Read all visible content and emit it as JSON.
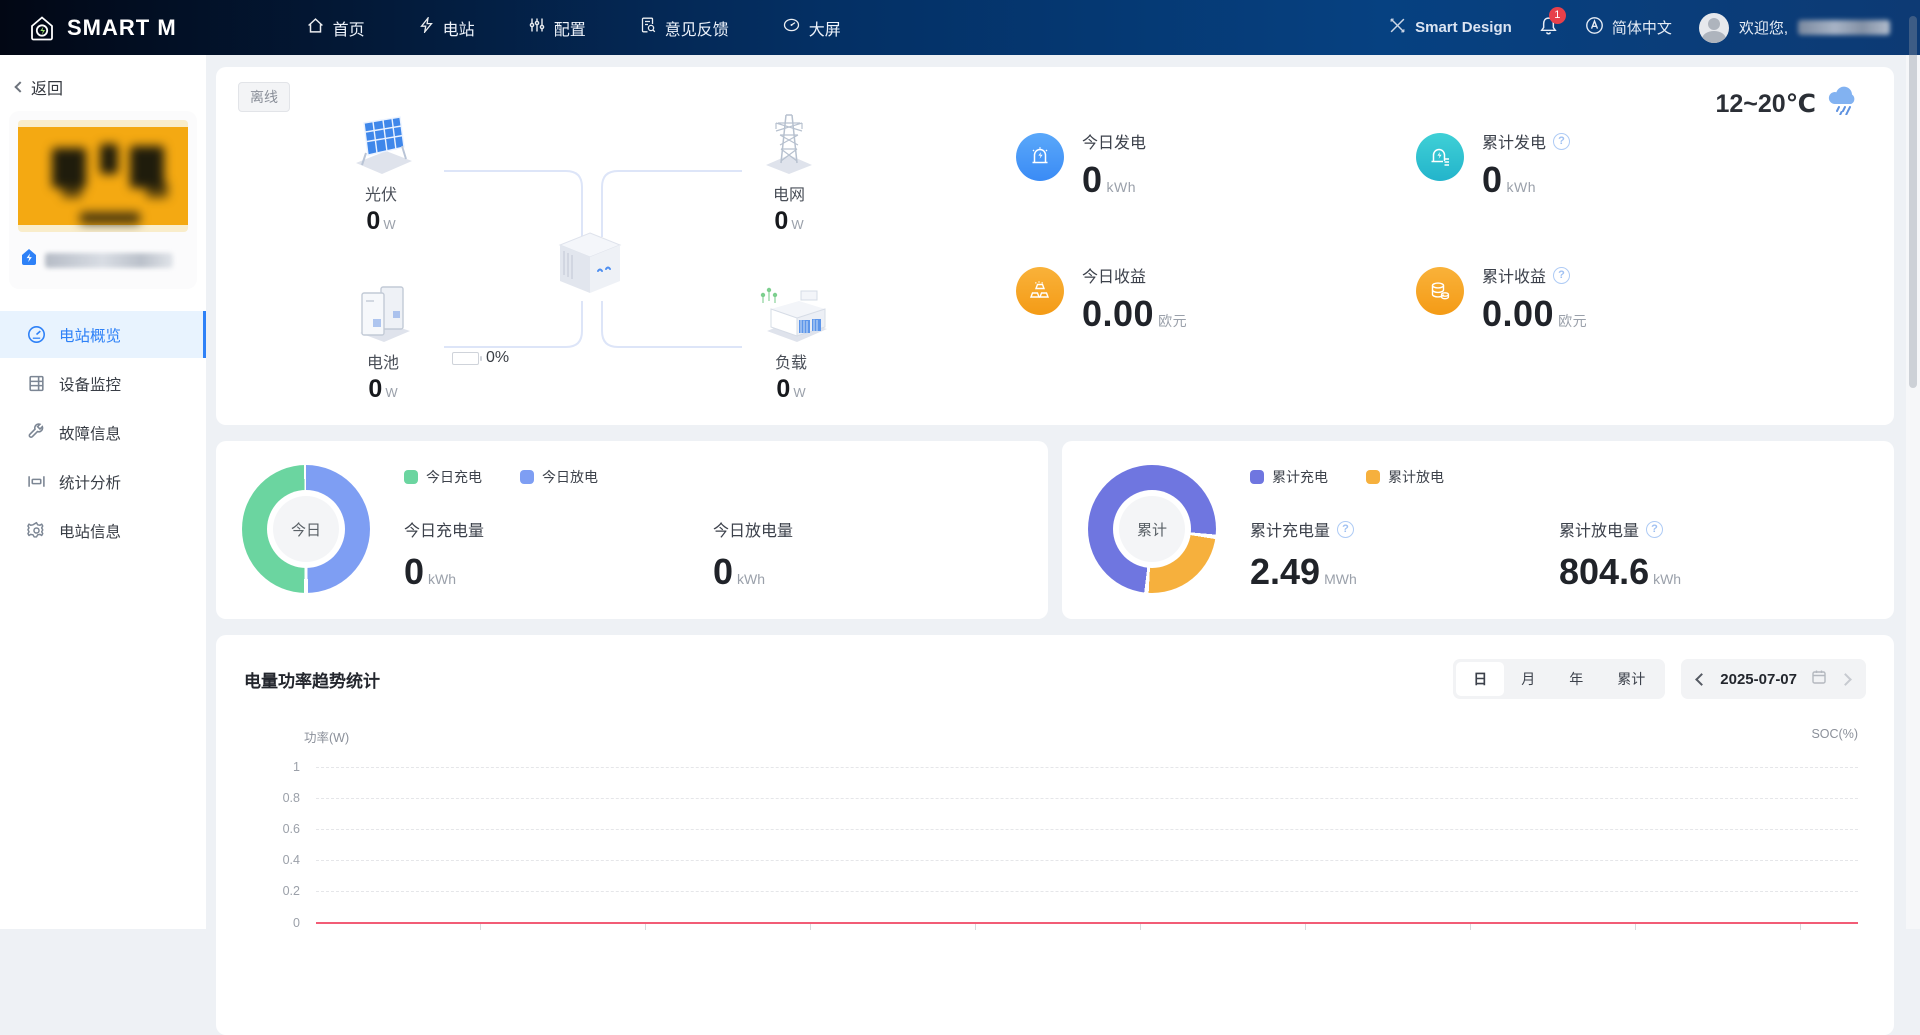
{
  "navbar": {
    "brand": "SMART M",
    "items": [
      {
        "label": "首页"
      },
      {
        "label": "电站"
      },
      {
        "label": "配置"
      },
      {
        "label": "意见反馈"
      },
      {
        "label": "大屏"
      }
    ],
    "design_label": "Smart Design",
    "notification_count": "1",
    "language_label": "简体中文",
    "welcome_label": "欢迎您,"
  },
  "sidebar": {
    "back_label": "返回",
    "menu": [
      {
        "label": "电站概览",
        "active": true
      },
      {
        "label": "设备监控",
        "active": false
      },
      {
        "label": "故障信息",
        "active": false
      },
      {
        "label": "统计分析",
        "active": false
      },
      {
        "label": "电站信息",
        "active": false
      }
    ]
  },
  "overview": {
    "status_badge": "离线",
    "weather": "12~20℃",
    "flow": {
      "pv_label": "光伏",
      "pv_value": "0",
      "pv_unit": "W",
      "grid_label": "电网",
      "grid_value": "0",
      "grid_unit": "W",
      "battery_label": "电池",
      "battery_value": "0",
      "battery_unit": "W",
      "battery_soc": "0%",
      "load_label": "负载",
      "load_value": "0",
      "load_unit": "W"
    },
    "stats": [
      {
        "label": "今日发电",
        "value": "0",
        "unit": "kWh"
      },
      {
        "label": "累计发电",
        "value": "0",
        "unit": "kWh"
      },
      {
        "label": "今日收益",
        "value": "0.00",
        "unit": "欧元"
      },
      {
        "label": "累计收益",
        "value": "0.00",
        "unit": "欧元"
      }
    ]
  },
  "today_card": {
    "donut_center": "今日",
    "legend": [
      {
        "label": "今日充电",
        "color": "#6bd5a0"
      },
      {
        "label": "今日放电",
        "color": "#7e9ef3"
      }
    ],
    "stats": [
      {
        "label": "今日充电量",
        "value": "0",
        "unit": "kWh"
      },
      {
        "label": "今日放电量",
        "value": "0",
        "unit": "kWh"
      }
    ]
  },
  "total_card": {
    "donut_center": "累计",
    "legend": [
      {
        "label": "累计充电",
        "color": "#6f76e0"
      },
      {
        "label": "累计放电",
        "color": "#f6b03d"
      }
    ],
    "stats": [
      {
        "label": "累计充电量",
        "value": "2.49",
        "unit": "MWh"
      },
      {
        "label": "累计放电量",
        "value": "804.6",
        "unit": "kWh"
      }
    ]
  },
  "trend": {
    "title": "电量功率趋势统计",
    "periods": [
      {
        "label": "日"
      },
      {
        "label": "月"
      },
      {
        "label": "年"
      },
      {
        "label": "累计"
      }
    ],
    "active_period": "日",
    "date": "2025-07-07",
    "ylabel_left": "功率(W)",
    "ylabel_right": "SOC(%)"
  },
  "chart_data": [
    {
      "type": "pie",
      "title": "今日充放电",
      "categories": [
        "今日充电",
        "今日放电"
      ],
      "values": [
        0,
        0
      ],
      "unit": "kWh",
      "colors": [
        "#6bd5a0",
        "#7e9ef3"
      ],
      "center_label": "今日",
      "note": "both values are 0 — donut rendered as two equal halves (green left, blue right)"
    },
    {
      "type": "pie",
      "title": "累计充放电",
      "categories": [
        "累计充电",
        "累计放电"
      ],
      "values": [
        2490,
        804.6
      ],
      "unit": "kWh",
      "colors": [
        "#6f76e0",
        "#f6b03d"
      ],
      "center_label": "累计",
      "note": "charge 2.49 MWh ≈ 75.6%, discharge 804.6 kWh ≈ 24.4% (orange lower-right segment)"
    },
    {
      "type": "line",
      "title": "电量功率趋势统计",
      "xlabel": "2025-07-07",
      "ylabel": "功率(W)",
      "ylabel_right": "SOC(%)",
      "ylim": [
        0,
        1
      ],
      "yticks": [
        "1",
        "0.8",
        "0.6",
        "0.4",
        "0.2",
        "0"
      ],
      "series": [
        {
          "name": "功率",
          "color": "#f25c76",
          "values": [
            0,
            0
          ],
          "note": "flat line at 0 across the whole day"
        }
      ],
      "grid": "dashed horizontal gridlines",
      "legend_position": "none"
    }
  ]
}
